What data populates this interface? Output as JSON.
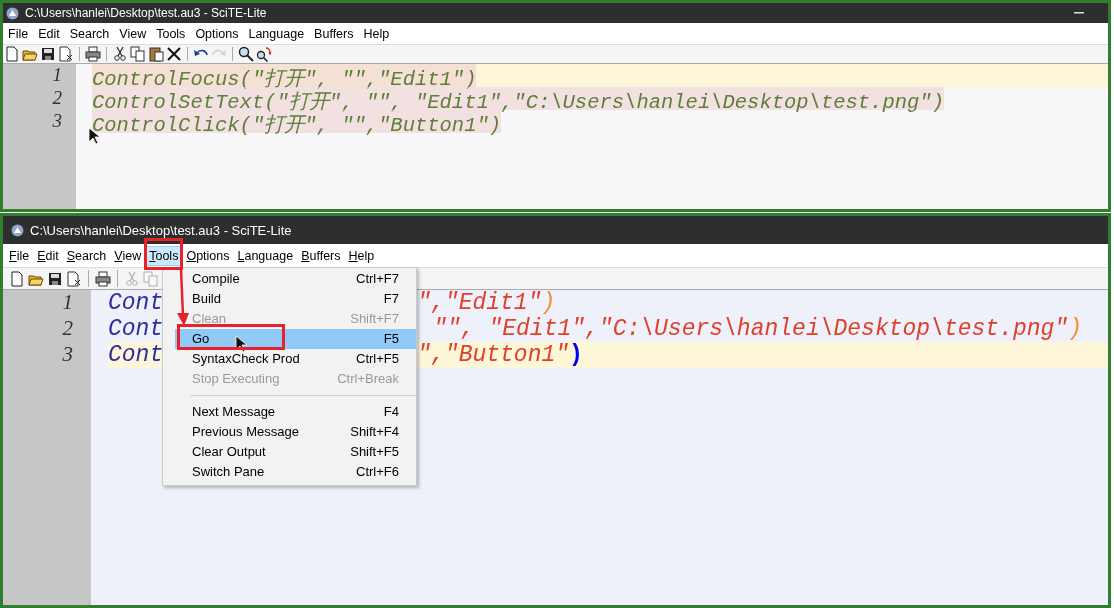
{
  "windows": [
    {
      "title": "C:\\Users\\hanlei\\Desktop\\test.au3 - SciTE-Lite",
      "show_access_keys": false,
      "menu": [
        {
          "label": "File",
          "selected": false
        },
        {
          "label": "Edit",
          "selected": false
        },
        {
          "label": "Search",
          "selected": false
        },
        {
          "label": "View",
          "selected": false
        },
        {
          "label": "Tools",
          "selected": false
        },
        {
          "label": "Options",
          "selected": false
        },
        {
          "label": "Language",
          "selected": false
        },
        {
          "label": "Buffers",
          "selected": false
        },
        {
          "label": "Help",
          "selected": false
        }
      ],
      "toolbar": [
        {
          "kind": "new",
          "disabled": false
        },
        {
          "kind": "open",
          "disabled": false
        },
        {
          "kind": "save",
          "disabled": false
        },
        {
          "kind": "close",
          "disabled": false
        },
        {
          "kind": "separator"
        },
        {
          "kind": "print",
          "disabled": false
        },
        {
          "kind": "separator"
        },
        {
          "kind": "cut",
          "disabled": false
        },
        {
          "kind": "copy",
          "disabled": false
        },
        {
          "kind": "paste",
          "disabled": false
        },
        {
          "kind": "delete",
          "disabled": false
        },
        {
          "kind": "separator"
        },
        {
          "kind": "undo",
          "disabled": false
        },
        {
          "kind": "redo",
          "disabled": true
        },
        {
          "kind": "separator"
        },
        {
          "kind": "find",
          "disabled": false
        },
        {
          "kind": "replace",
          "disabled": false
        }
      ],
      "lines": [
        {
          "number": "1",
          "current": true,
          "selected": true,
          "segments": [
            {
              "kind": "plain",
              "text": "ControlFocus(\"打开\", \"\",\"Edit1\")"
            }
          ]
        },
        {
          "number": "2",
          "current": false,
          "selected": true,
          "segments": [
            {
              "kind": "plain",
              "text": "ControlSetText(\"打开\", \"\", \"Edit1\",\"C:\\Users\\hanlei\\Desktop\\test.png\")"
            }
          ]
        },
        {
          "number": "3",
          "current": false,
          "selected": true,
          "segments": [
            {
              "kind": "plain",
              "text": "ControlClick(\"打开\", \"\",\"Button1\")"
            }
          ]
        }
      ]
    },
    {
      "title": "C:\\Users\\hanlei\\Desktop\\test.au3 - SciTE-Lite",
      "show_access_keys": true,
      "menu": [
        {
          "label": "File",
          "selected": false
        },
        {
          "label": "Edit",
          "selected": false
        },
        {
          "label": "Search",
          "selected": false
        },
        {
          "label": "View",
          "selected": false
        },
        {
          "label": "Tools",
          "selected": true
        },
        {
          "label": "Options",
          "selected": false
        },
        {
          "label": "Language",
          "selected": false
        },
        {
          "label": "Buffers",
          "selected": false
        },
        {
          "label": "Help",
          "selected": false
        }
      ],
      "toolbar": [
        {
          "kind": "new",
          "disabled": false
        },
        {
          "kind": "open",
          "disabled": false
        },
        {
          "kind": "save",
          "disabled": false
        },
        {
          "kind": "close",
          "disabled": false
        },
        {
          "kind": "separator"
        },
        {
          "kind": "print",
          "disabled": false
        },
        {
          "kind": "separator"
        },
        {
          "kind": "cut",
          "disabled": true
        },
        {
          "kind": "copy",
          "disabled": true
        }
      ],
      "lines": [
        {
          "number": "1",
          "current": false,
          "selected": false,
          "segments": [
            {
              "kind": "function",
              "text": "Cont"
            },
            {
              "kind": "string",
              "text": "\",\"Edit1\""
            },
            {
              "kind": "operator",
              "text": ")"
            }
          ]
        },
        {
          "number": "2",
          "current": false,
          "selected": false,
          "segments": [
            {
              "kind": "function",
              "text": "Cont"
            },
            {
              "kind": "string",
              "text": "\"\", \"Edit1\",\"C:\\Users\\hanlei\\Desktop\\test.png\""
            },
            {
              "kind": "operator",
              "text": ")"
            }
          ]
        },
        {
          "number": "3",
          "current": true,
          "selected": false,
          "segments": [
            {
              "kind": "function",
              "text": "Cont"
            },
            {
              "kind": "string",
              "text": "\",\"Button1\""
            },
            {
              "kind": "brace",
              "text": ")"
            }
          ]
        }
      ],
      "dropdown": [
        {
          "kind": "item",
          "label": "Compile",
          "shortcut": "Ctrl+F7",
          "disabled": false,
          "selected": false
        },
        {
          "kind": "item",
          "label": "Build",
          "shortcut": "F7",
          "disabled": false,
          "selected": false
        },
        {
          "kind": "item",
          "label": "Clean",
          "shortcut": "Shift+F7",
          "disabled": true,
          "selected": false
        },
        {
          "kind": "item",
          "label": "Go",
          "shortcut": "F5",
          "disabled": false,
          "selected": true
        },
        {
          "kind": "item",
          "label": "SyntaxCheck Prod",
          "shortcut": "Ctrl+F5",
          "disabled": false,
          "selected": false
        },
        {
          "kind": "item",
          "label": "Stop Executing",
          "shortcut": "Ctrl+Break",
          "disabled": true,
          "selected": false
        },
        {
          "kind": "separator"
        },
        {
          "kind": "item",
          "label": "Next Message",
          "shortcut": "F4",
          "disabled": false,
          "selected": false
        },
        {
          "kind": "item",
          "label": "Previous Message",
          "shortcut": "Shift+F4",
          "disabled": false,
          "selected": false
        },
        {
          "kind": "item",
          "label": "Clear Output",
          "shortcut": "Shift+F5",
          "disabled": false,
          "selected": false
        },
        {
          "kind": "item",
          "label": "Switch Pane",
          "shortcut": "Ctrl+F6",
          "disabled": false,
          "selected": false
        }
      ]
    }
  ]
}
